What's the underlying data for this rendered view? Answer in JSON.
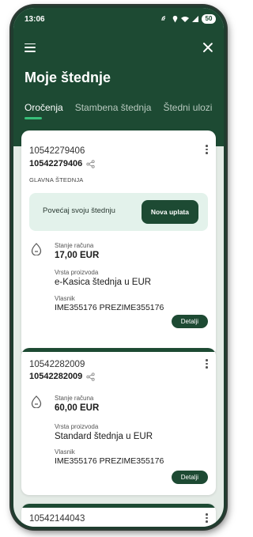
{
  "status_bar": {
    "time": "13:06",
    "battery": "50"
  },
  "page": {
    "title": "Moje štednje"
  },
  "tabs": [
    {
      "label": "Oročenja"
    },
    {
      "label": "Stambena štednja"
    },
    {
      "label": "Štedni ulozi"
    }
  ],
  "cards": [
    {
      "account_number": "10542279406",
      "account_number_bold": "10542279406",
      "tag": "GLAVNA ŠTEDNJA",
      "promo_text": "Povećaj svoju štednju",
      "promo_button": "Nova uplata",
      "balance_label": "Stanje računa",
      "balance": "17,00 EUR",
      "product_label": "Vrsta proizvoda",
      "product": "e-Kasica štednja u EUR",
      "owner_label": "Vlasnik",
      "owner": "IME355176 PREZIME355176",
      "details_button": "Detalji"
    },
    {
      "account_number": "10542282009",
      "account_number_bold": "10542282009",
      "balance_label": "Stanje računa",
      "balance": "60,00 EUR",
      "product_label": "Vrsta proizvoda",
      "product": "Standard štednja u EUR",
      "owner_label": "Vlasnik",
      "owner": "IME355176 PREZIME355176",
      "details_button": "Detalji"
    },
    {
      "account_number": "10542144043",
      "account_number_bold": "10542144043"
    }
  ],
  "colors": {
    "brand_dark": "#1d4a33",
    "accent": "#38c07a",
    "promo_bg": "#e3f2eb"
  },
  "icons": [
    "menu-icon",
    "close-icon",
    "share-icon",
    "more-options-icon",
    "wallet-icon"
  ]
}
